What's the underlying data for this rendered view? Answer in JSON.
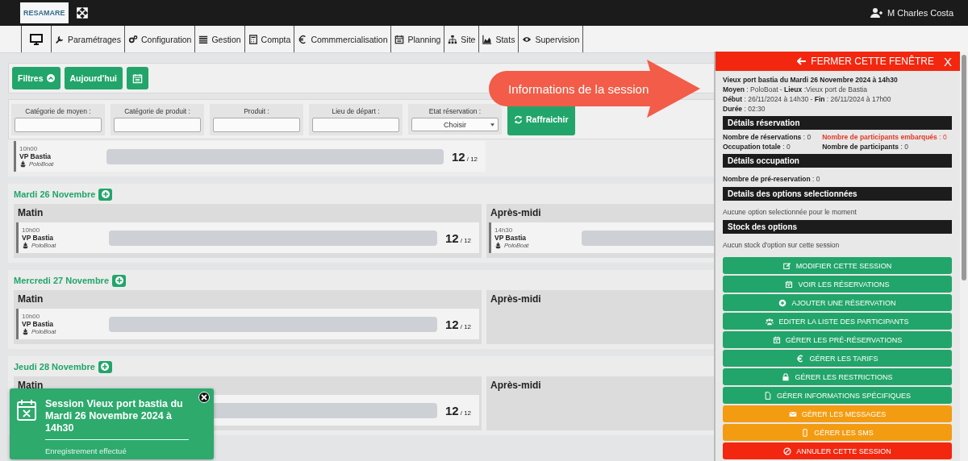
{
  "top_bar": {
    "logo_text": "RESAMARE",
    "user_name": "M Charles Costa"
  },
  "nav": [
    {
      "label": "Paramétrages"
    },
    {
      "label": "Configuration"
    },
    {
      "label": "Gestion"
    },
    {
      "label": "Compta"
    },
    {
      "label": "Commmercialisation"
    },
    {
      "label": "Planning"
    },
    {
      "label": "Site"
    },
    {
      "label": "Stats"
    },
    {
      "label": "Supervision"
    }
  ],
  "toolbar": {
    "filters_button": "Filtres",
    "today_button": "Aujourd'hui"
  },
  "filters": [
    {
      "label": "Catégorie de moyen :",
      "kind": "text"
    },
    {
      "label": "Catégorie de produit :",
      "kind": "text"
    },
    {
      "label": "Produit :",
      "kind": "text"
    },
    {
      "label": "Lieu de départ :",
      "kind": "text"
    },
    {
      "label": "Etat réservation :",
      "kind": "select",
      "value": "Choisir"
    }
  ],
  "refresh_button": "Raffraichir",
  "top_session": {
    "time": "10h00",
    "name": "VP Bastia",
    "boat": "PoloBoat",
    "count": "12",
    "capacity": "/ 12"
  },
  "days": [
    {
      "title": "Mardi 26 Novembre",
      "slots": [
        {
          "label": "Matin",
          "sessions": [
            {
              "time": "10h00",
              "name": "VP Bastia",
              "boat": "PoloBoat",
              "count": "12",
              "capacity": "/ 12"
            }
          ]
        },
        {
          "label": "Après-midi",
          "sessions": [
            {
              "time": "14h30",
              "name": "VP Bastia",
              "boat": "PoloBoat"
            }
          ]
        }
      ]
    },
    {
      "title": "Mercredi 27 Novembre",
      "slots": [
        {
          "label": "Matin",
          "sessions": [
            {
              "time": "10h00",
              "name": "VP Bastia",
              "boat": "PoloBoat",
              "count": "12",
              "capacity": "/ 12"
            }
          ]
        },
        {
          "label": "Après-midi"
        }
      ]
    },
    {
      "title": "Jeudi 28 Novembre",
      "slots": [
        {
          "label": "Matin",
          "sessions": [
            {
              "count": "12",
              "capacity": "/ 12"
            }
          ]
        },
        {
          "label": "Après-midi"
        }
      ]
    }
  ],
  "panel": {
    "close_label": "FERMER CETTE FENÊTRE",
    "close_x": "X",
    "title": "Vieux port bastia du Mardi 26 Novembre 2024 à 14h30",
    "info_lines": [
      "**Moyen** : PoloBoat - **Lieux** :Vieux port de Bastia",
      "**Début** : 26/11/2024 à 14h30 - **Fin** : 26/11/2024 à 17h00",
      "**Durée** : 02:30"
    ],
    "sections": [
      {
        "heading": "Détails réservation",
        "kind": "grid",
        "lines": [
          {
            "text": "**Nombre de réservations** : 0",
            "alert": false
          },
          {
            "text": "**Nombre de participants embarqués** : 0",
            "alert": true
          },
          {
            "text": "**Occupation totale** : 0",
            "alert": false
          },
          {
            "text": "**Nombre de participants** : 0",
            "alert": false
          }
        ]
      },
      {
        "heading": "Détails occupation",
        "kind": "list",
        "lines": [
          {
            "text": "**Nombre de pré-reservation** : 0",
            "alert": false
          }
        ]
      },
      {
        "heading": "Details des options selectionnées",
        "kind": "list",
        "lines": [
          {
            "text": "Aucune option selectionnée pour le moment",
            "alert": false
          }
        ]
      },
      {
        "heading": "Stock des options",
        "kind": "list",
        "lines": [
          {
            "text": "Aucun stock d'option sur cette session",
            "alert": false
          }
        ]
      }
    ],
    "actions": [
      {
        "label": "MODIFIER CETTE SESSION",
        "kind": "primary"
      },
      {
        "label": "VOIR LES RÉSERVATIONS",
        "kind": "primary"
      },
      {
        "label": "AJOUTER UNE RÉSERVATION",
        "kind": "primary"
      },
      {
        "label": "EDITER LA LISTE DES PARTICIPANTS",
        "kind": "primary"
      },
      {
        "label": "GÉRER LES PRÉ-RÉSERVATIONS",
        "kind": "primary"
      },
      {
        "label": "GÉRER LES TARIFS",
        "kind": "primary"
      },
      {
        "label": "GÉRER LES RESTRICTIONS",
        "kind": "primary"
      },
      {
        "label": "GÉRER INFORMATIONS SPÉCIFIQUES",
        "kind": "primary"
      },
      {
        "label": "GÉRER LES MESSAGES",
        "kind": "warning"
      },
      {
        "label": "GÉRER LES SMS",
        "kind": "warning"
      },
      {
        "label": "ANNULER CETTE SESSION",
        "kind": "danger"
      }
    ]
  },
  "callout": {
    "text": "Informations de la session"
  },
  "toast": {
    "title": "Session Vieux port bastia du Mardi 26 Novembre 2024 à 14h30",
    "message": "Enregistrement effectué"
  }
}
